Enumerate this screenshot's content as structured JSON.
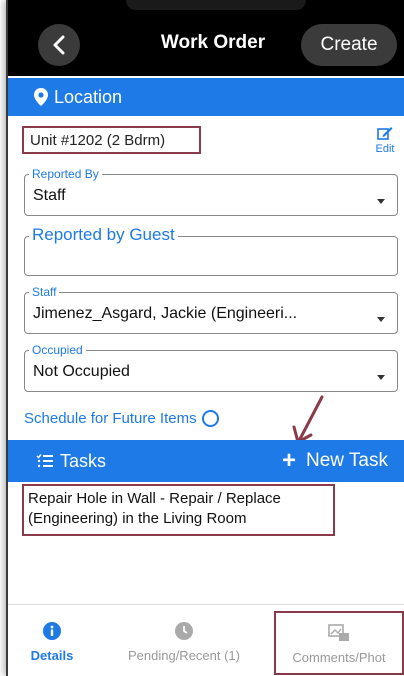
{
  "header": {
    "title": "Work Order",
    "create_label": "Create"
  },
  "location": {
    "section_label": "Location",
    "unit": "Unit #1202 (2 Bdrm)",
    "edit_label": "Edit"
  },
  "fields": {
    "reported_by": {
      "label": "Reported By",
      "value": "Staff"
    },
    "reported_by_guest": {
      "label": "Reported by Guest",
      "value": ""
    },
    "staff": {
      "label": "Staff",
      "value": "Jimenez_Asgard, Jackie (Engineeri..."
    },
    "occupied": {
      "label": "Occupied",
      "value": "Not Occupied"
    }
  },
  "schedule": {
    "label": "Schedule for Future Items"
  },
  "tasks": {
    "section_label": "Tasks",
    "new_task_label": "New Task",
    "items": [
      "Repair Hole in Wall - Repair / Replace (Engineering) in the Living Room"
    ]
  },
  "tabs": [
    {
      "label": "Details",
      "icon": "info-icon"
    },
    {
      "label": "Pending/Recent (1)",
      "icon": "clock-icon"
    },
    {
      "label": "Comments/Phot",
      "icon": "photos-icon"
    }
  ],
  "colors": {
    "accent": "#1e7ae6",
    "highlight_border": "#8b3a4a"
  }
}
